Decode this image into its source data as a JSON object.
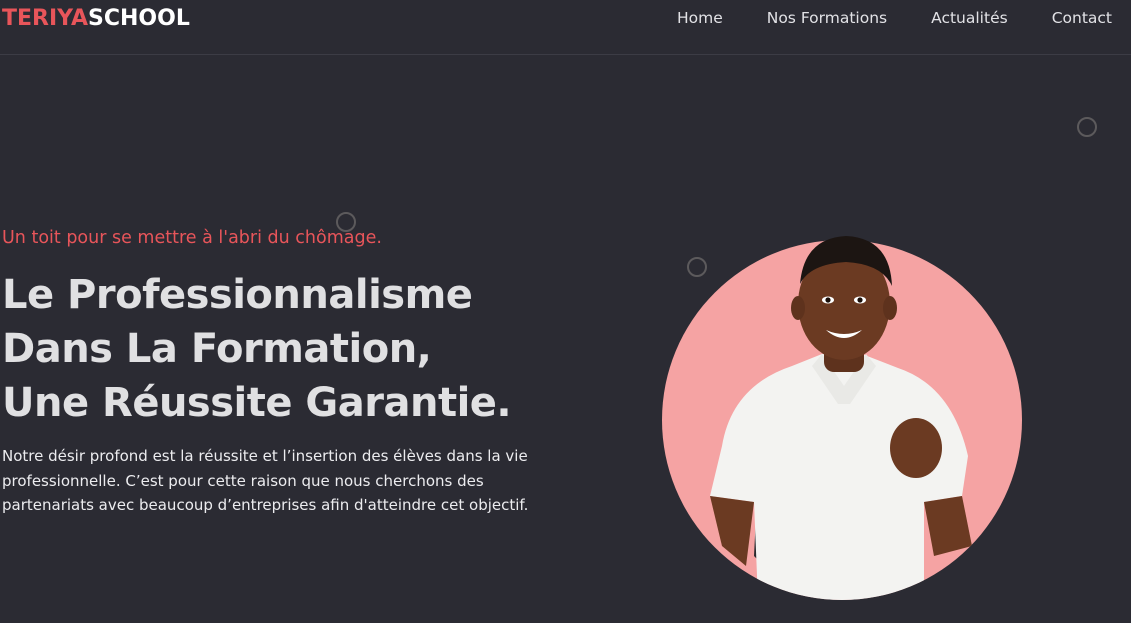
{
  "brand": {
    "accent_part": "TERIYA",
    "main_part": "SCHOOL",
    "accent_color": "#e8555a"
  },
  "nav": {
    "items": [
      {
        "label": "Home"
      },
      {
        "label": "Nos Formations"
      },
      {
        "label": "Actualités"
      },
      {
        "label": "Contact"
      }
    ]
  },
  "hero": {
    "tagline": "Un toit pour se mettre à l'abri du chômage.",
    "headline_lines": [
      "Le Professionnalisme",
      "Dans La Formation,",
      "Une Réussite Garantie."
    ],
    "description": "Notre désir profond est la réussite et l’insertion des élèves dans la vie professionnelle. C’est pour cette raison que nous cherchons des partenariats avec beaucoup d’entreprises afin d'atteindre cet objectif.",
    "image_subject": "student-photo"
  },
  "colors": {
    "background": "#2b2b33",
    "accent": "#e8555a",
    "circle_fill": "#f5a3a3"
  }
}
